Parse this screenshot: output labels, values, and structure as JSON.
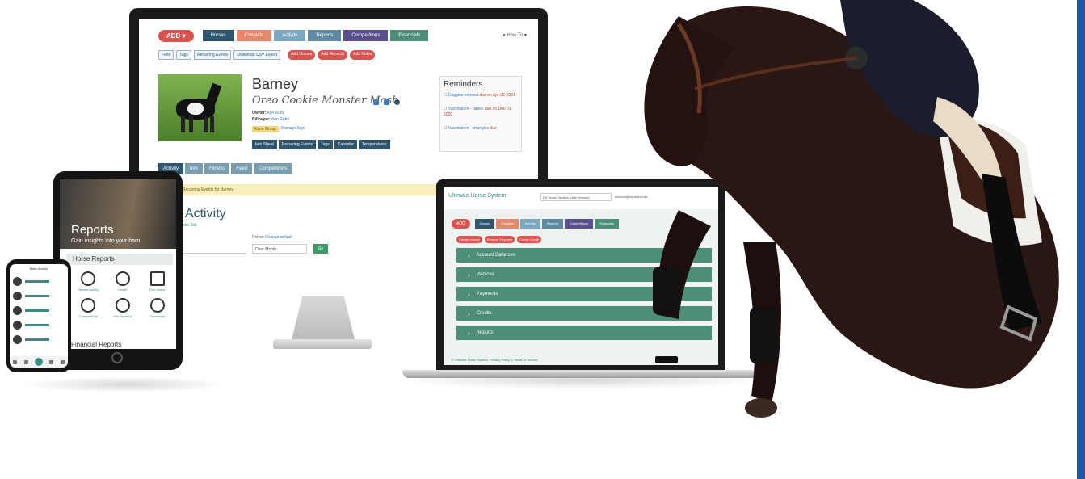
{
  "desktop": {
    "add_label": "ADD",
    "nav": [
      {
        "label": "Horses",
        "color": "#2f5570"
      },
      {
        "label": "Contacts",
        "color": "#e8876a"
      },
      {
        "label": "Activity",
        "color": "#79a8c0"
      },
      {
        "label": "Reports",
        "color": "#5e8aa3"
      },
      {
        "label": "Competitions",
        "color": "#5a4f8c"
      },
      {
        "label": "Financials",
        "color": "#4c8f76"
      }
    ],
    "help": "How To",
    "sub_buttons": [
      "Feed",
      "Tags",
      "Recurring Events",
      "Download CSV Export"
    ],
    "add_buttons": [
      "Add Horses",
      "Add Records",
      "Add Notes"
    ],
    "horse": {
      "name": "Barney",
      "registered_name": "Oreo Cookie Monster Mash",
      "owner_label": "Owner:",
      "owner": "Ann Ruby",
      "biller_label": "Billpayer:",
      "biller": "Ann Ruby",
      "group": "Kane Group",
      "manage": "Manage Sign",
      "buttons": [
        "Info Sheet",
        "Recurring Events",
        "Tags",
        "Calendar",
        "Temperatures"
      ]
    },
    "reminders": {
      "title": "Reminders",
      "items": [
        {
          "text": "Coggins renewal",
          "due": "due on Apr-03-2021"
        },
        {
          "text": "Vaccination - rabies",
          "due": "due on Dec-01-2020"
        },
        {
          "text": "Vaccination - strangles",
          "due": "due"
        }
      ]
    },
    "tabs": [
      "Activity",
      "Info",
      "Fitness",
      "Feed",
      "Competitions"
    ],
    "banner": "Recurring Events for Barney",
    "activity_title": "nt Activity",
    "activity_sub": "Calendar Tab",
    "period_label": "Period",
    "period_value": "Change default",
    "period_select": "Over Month",
    "go": "Go"
  },
  "laptop": {
    "logo": "Ultimate Horse System",
    "barn_select": "ES Horse Studios (User Horses)",
    "account": "account@equinex.com",
    "add_label": "ADD",
    "nav": [
      {
        "label": "Horses",
        "color": "#2f5570"
      },
      {
        "label": "Contacts",
        "color": "#e8876a"
      },
      {
        "label": "Activity",
        "color": "#79a8c0"
      },
      {
        "label": "Reports",
        "color": "#5e8aa3"
      },
      {
        "label": "Competitions",
        "color": "#5a4f8c"
      },
      {
        "label": "Financials",
        "color": "#4c8f76"
      }
    ],
    "buttons": [
      "Create Invoice",
      "Receive Payment",
      "Create Credit"
    ],
    "sections": [
      "Account Balances",
      "Invoices",
      "Payments",
      "Credits",
      "Reports"
    ],
    "footer": "© Ultimate Horse System. Privacy Policy & Terms of Service"
  },
  "tablet": {
    "title": "Reports",
    "subtitle": "Gain insights into your barn",
    "section": "Horse Reports",
    "items": [
      "Recent Activity",
      "Health",
      "Due Dates",
      "Competitions",
      "Info Sections",
      "Ownership"
    ],
    "financial": "Financial Reports"
  },
  "phone": {
    "title": "Barn Horses"
  },
  "colors": {
    "accent_red": "#d9534f",
    "teal": "#4c8f76",
    "navy": "#2f5570",
    "edge_blue": "#1e57a8"
  }
}
